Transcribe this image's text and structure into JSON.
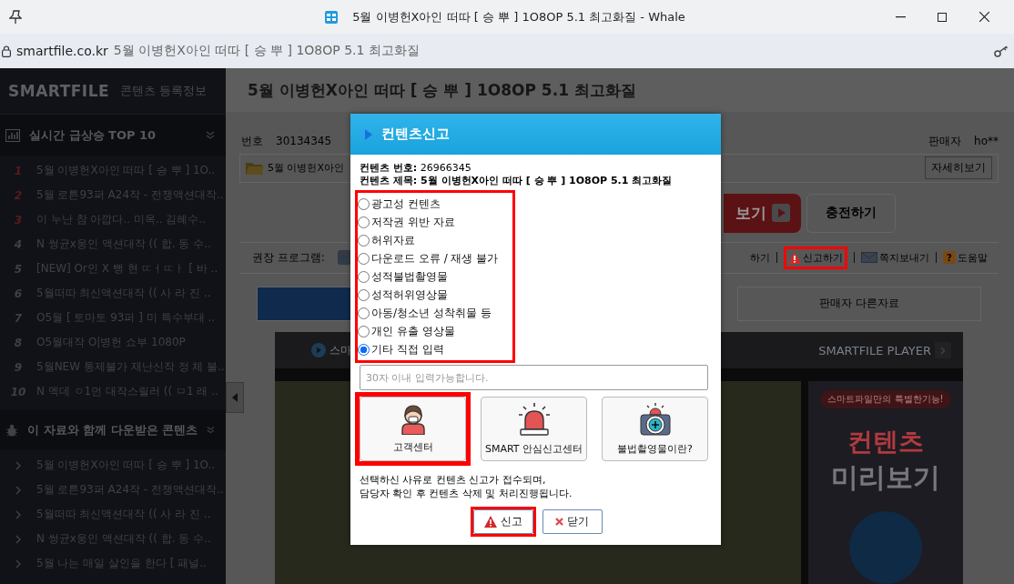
{
  "browser": {
    "title": "5월 이병헌X아인 떠따 [ 승 뿌 ] 1O8OP 5.1 최고화질 - Whale",
    "url_host": "smartfile.co.kr",
    "url_title": "5월 이병헌X아인 떠따 [ 승 뿌 ] 1O8OP 5.1 최고화질"
  },
  "sidebar": {
    "logo": "SMARTFILE",
    "logo_caption": "콘텐츠 등록정보",
    "sections": [
      {
        "kind": "ranked",
        "title": "실시간 급상승 TOP 10",
        "items": [
          {
            "rank": "1",
            "text": "5월 이병헌X아인 떠따 [ 승 뿌 ] 1O.."
          },
          {
            "rank": "2",
            "text": "5월 로튼93퍼 A24작 - 전쟁액션대작.."
          },
          {
            "rank": "3",
            "text": "이 누난 참 아깝다.. 미옥.. 김혜수.."
          },
          {
            "rank": "4",
            "text": "N 썽균x웅인 액션대작 (( 합. 동 수.."
          },
          {
            "rank": "5",
            "text": "[NEW] Or인 X 뻥 현 ㄸㅓㄸㅏ [ 바 .."
          },
          {
            "rank": "6",
            "text": "5월떠따 최신액션대작 (( 사 라 진 .."
          },
          {
            "rank": "7",
            "text": "O5월 [ 토마토 93퍼 ] 미 특수부대 .."
          },
          {
            "rank": "8",
            "text": "O5월대작 O|병헌 쇼부 1080P"
          },
          {
            "rank": "9",
            "text": "5월NEW 통제불가 재난신작 정 체 불.."
          },
          {
            "rank": "10",
            "text": "N 멕데 ㅇ1먼 대작스릴러 (( ㅁ1 래 .."
          }
        ]
      },
      {
        "kind": "related",
        "title": "이 자료와 함께 다운받은 콘텐츠",
        "items": [
          {
            "text": "5월 이병헌X아인 떠따 [ 승 뿌 ] 1O.."
          },
          {
            "text": "5월 로튼93퍼 A24작 - 전쟁액션대작.."
          },
          {
            "text": "5월떠따 최신액션대작 (( 사 라 진 .."
          },
          {
            "text": "N 썽균x웅인 액션대작 (( 합. 동 수.."
          },
          {
            "text": "5월 나는 매일 살인을 한다 [ 패널.."
          }
        ]
      }
    ]
  },
  "content": {
    "title": "5월 이병헌X아인 떠따 [ 승 뿌 ] 1O8OP 5.1 최고화질",
    "number_label": "번호",
    "number": "30134345",
    "seller_label": "판매자",
    "seller": "ho**",
    "file_name": "5월 이병헌X아인",
    "details_button": "자세히보기",
    "view_button": "보기",
    "charge_button": "충전하기",
    "program_label": "권장 프로그램:",
    "links": [
      {
        "kind": "plain",
        "label": "하기",
        "highlighted": false
      },
      {
        "kind": "report",
        "label": "신고하기",
        "highlighted": true
      },
      {
        "kind": "message",
        "label": "쪽지보내기",
        "highlighted": false
      },
      {
        "kind": "help",
        "icon": "?",
        "label": "도움말",
        "highlighted": false
      }
    ],
    "tabs": [
      {
        "selected": true
      },
      {
        "label": "판매자 다른자료",
        "selected": false
      }
    ],
    "player": {
      "label": "스마",
      "brand": "SMARTFILE PLAYER",
      "ad_caption": "스마트파일만의 특별한기능!",
      "ad_title": "컨텐츠",
      "ad_subtitle": "미리보기"
    }
  },
  "dialog": {
    "title": "컨텐츠신고",
    "number_line": "**컨텐츠 번호:** 26966345",
    "title_line": "컨텐츠 제목: 5월 이병헌X아인 떠따 [ 승 뿌 ] 1O8OP 5.1 최고화질",
    "reasons_highlighted": true,
    "reasons": [
      {
        "label": "광고성 컨텐츠",
        "selected": false
      },
      {
        "label": "저작권 위반 자료",
        "selected": false
      },
      {
        "label": "허위자료",
        "selected": false
      },
      {
        "label": "다운로드 오류 / 재생 불가",
        "selected": false
      },
      {
        "label": "성적불법촬영물",
        "selected": false
      },
      {
        "label": "성적허위영상물",
        "selected": false
      },
      {
        "label": "아동/청소년 성착취물 등",
        "selected": false
      },
      {
        "label": "개인 유출 영상물",
        "selected": false
      },
      {
        "label": "기타 직접 입력",
        "selected": true
      }
    ],
    "input": {
      "placeholder": "30자 이내 입력가능합니다."
    },
    "help_buttons": [
      {
        "kind": "person",
        "label": "고객센터",
        "highlighted": true
      },
      {
        "kind": "siren",
        "label": "SMART 안심신고센터",
        "highlighted": false
      },
      {
        "kind": "camera",
        "label": "불법촬영물이란?",
        "highlighted": false
      }
    ],
    "notice": "선택하신 사유로 컨텐츠 신고가 접수되며,\n담당자 확인 후 컨텐츠 삭제 및 처리진행됩니다.",
    "actions": [
      {
        "kind": "report",
        "label": "신고",
        "highlighted": true
      },
      {
        "kind": "close",
        "label": "닫기",
        "highlighted": false
      }
    ]
  }
}
